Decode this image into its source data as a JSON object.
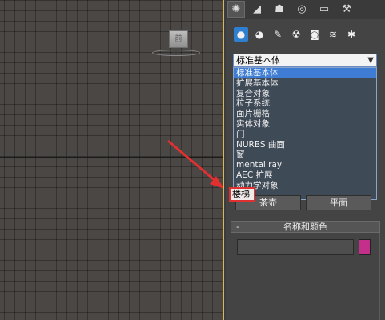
{
  "viewport": {
    "viewcube_label": "前"
  },
  "panel": {
    "tabs": [
      {
        "name": "create-tab",
        "glyph": "✺"
      },
      {
        "name": "modify-tab",
        "glyph": "◢"
      },
      {
        "name": "hierarchy-tab",
        "glyph": "☗"
      },
      {
        "name": "motion-tab",
        "glyph": "◎"
      },
      {
        "name": "display-tab",
        "glyph": "▭"
      },
      {
        "name": "utilities-tab",
        "glyph": "⚒"
      }
    ],
    "subcategories": [
      {
        "name": "geometry-icon",
        "glyph": "●"
      },
      {
        "name": "shapes-icon",
        "glyph": "◕"
      },
      {
        "name": "lights-icon",
        "glyph": "✎"
      },
      {
        "name": "cameras-icon",
        "glyph": "☢"
      },
      {
        "name": "helpers-icon",
        "glyph": "◙"
      },
      {
        "name": "spacewarps-icon",
        "glyph": "≋"
      },
      {
        "name": "systems-icon",
        "glyph": "✱"
      }
    ],
    "dropdown": {
      "selected": "标准基本体",
      "options": [
        "标准基本体",
        "扩展基本体",
        "复合对象",
        "粒子系统",
        "面片栅格",
        "实体对象",
        "门",
        "NURBS 曲面",
        "窗",
        "mental ray",
        "AEC 扩展",
        "动力学对象"
      ],
      "highlighted_option": "楼梯"
    },
    "buttons": {
      "left": "茶壶",
      "right": "平面"
    },
    "rollout": {
      "toggle": "-",
      "title": "名称和颜色"
    },
    "colors": {
      "object_color": "#c42f8c",
      "selection_highlight": "#3e7dd3",
      "callout_red": "#e03030"
    }
  }
}
